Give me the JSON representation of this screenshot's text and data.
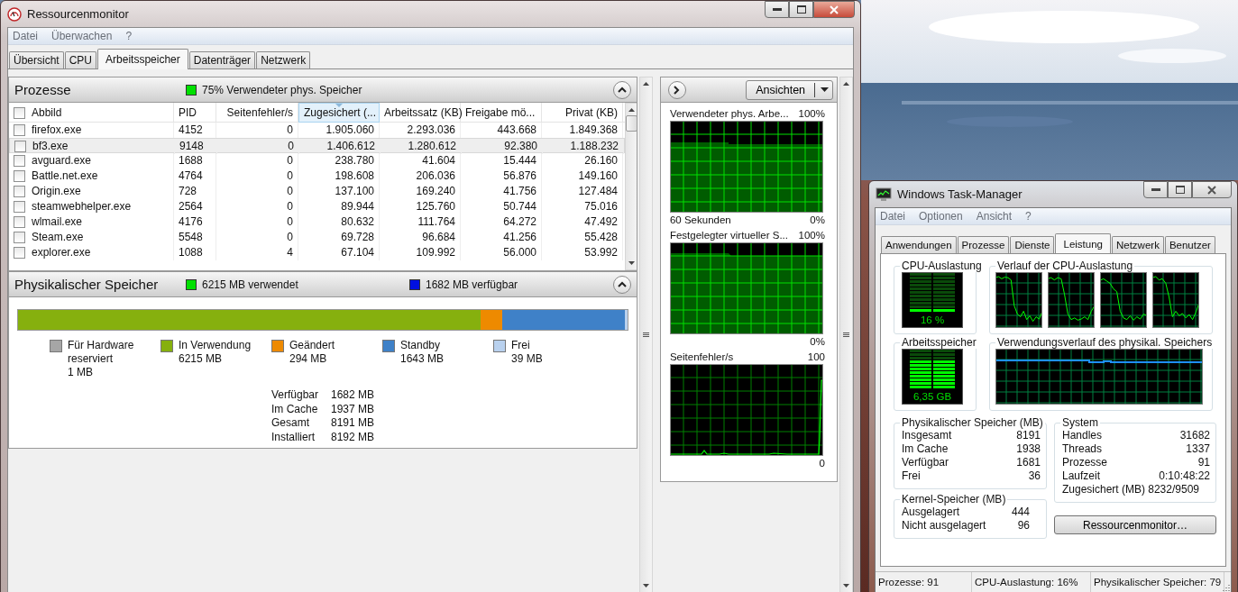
{
  "resmon": {
    "title": "Ressourcenmonitor",
    "menu": [
      "Datei",
      "Überwachen",
      "?"
    ],
    "tabs": [
      {
        "label": "Übersicht",
        "selected": false
      },
      {
        "label": "CPU",
        "selected": false
      },
      {
        "label": "Arbeitsspeicher",
        "selected": true
      },
      {
        "label": "Datenträger",
        "selected": false
      },
      {
        "label": "Netzwerk",
        "selected": false
      }
    ],
    "processes": {
      "title": "Prozesse",
      "status": "75% Verwendeter phys. Speicher",
      "columns": [
        {
          "label": "Abbild",
          "sorted": false
        },
        {
          "label": "PID",
          "sorted": false
        },
        {
          "label": "Seitenfehler/s",
          "sorted": false
        },
        {
          "label": "Zugesichert (...",
          "sorted": true
        },
        {
          "label": "Arbeitssatz (KB)",
          "sorted": false
        },
        {
          "label": "Freigabe mö...",
          "sorted": false
        },
        {
          "label": "Privat (KB)",
          "sorted": false
        }
      ],
      "rows": [
        {
          "checked": false,
          "selected": false,
          "cells": [
            "firefox.exe",
            "4152",
            "0",
            "1.905.060",
            "2.293.036",
            "443.668",
            "1.849.368"
          ]
        },
        {
          "checked": false,
          "selected": true,
          "cells": [
            "bf3.exe",
            "9148",
            "0",
            "1.406.612",
            "1.280.612",
            "92.380",
            "1.188.232"
          ]
        },
        {
          "checked": false,
          "selected": false,
          "cells": [
            "avguard.exe",
            "1688",
            "0",
            "238.780",
            "41.604",
            "15.444",
            "26.160"
          ]
        },
        {
          "checked": false,
          "selected": false,
          "cells": [
            "Battle.net.exe",
            "4764",
            "0",
            "198.608",
            "206.036",
            "56.876",
            "149.160"
          ]
        },
        {
          "checked": false,
          "selected": false,
          "cells": [
            "Origin.exe",
            "728",
            "0",
            "137.100",
            "169.240",
            "41.756",
            "127.484"
          ]
        },
        {
          "checked": false,
          "selected": false,
          "cells": [
            "steamwebhelper.exe",
            "2564",
            "0",
            "89.944",
            "125.760",
            "50.744",
            "75.016"
          ]
        },
        {
          "checked": false,
          "selected": false,
          "cells": [
            "wlmail.exe",
            "4176",
            "0",
            "80.632",
            "111.764",
            "64.272",
            "47.492"
          ]
        },
        {
          "checked": false,
          "selected": false,
          "cells": [
            "Steam.exe",
            "5548",
            "0",
            "69.728",
            "96.684",
            "41.256",
            "55.428"
          ]
        },
        {
          "checked": false,
          "selected": false,
          "cells": [
            "explorer.exe",
            "1088",
            "4",
            "67.104",
            "109.992",
            "56.000",
            "53.992"
          ]
        }
      ]
    },
    "memory": {
      "title": "Physikalischer Speicher",
      "used": "6215 MB verwendet",
      "available": "1682 MB verfügbar",
      "segments": [
        {
          "label": "Für Hardware reserviert",
          "value": "1 MB",
          "color": "#a6a6a6"
        },
        {
          "label": "In Verwendung",
          "value": "6215 MB",
          "color": "#86b00e"
        },
        {
          "label": "Geändert",
          "value": "294 MB",
          "color": "#ee8a00"
        },
        {
          "label": "Standby",
          "value": "1643 MB",
          "color": "#3f81c8"
        },
        {
          "label": "Frei",
          "value": "39 MB",
          "color": "#b9d1ee"
        }
      ],
      "stats": [
        {
          "label": "Verfügbar",
          "value": "1682 MB"
        },
        {
          "label": "Im Cache",
          "value": "1937 MB"
        },
        {
          "label": "Gesamt",
          "value": "8191 MB"
        },
        {
          "label": "Installiert",
          "value": "8192 MB"
        }
      ]
    },
    "views_button": "Ansichten",
    "graphs": [
      {
        "kind": "fill",
        "title": "Verwendeter phys. Arbe...",
        "max": "100%",
        "min": "0%",
        "caption": "60 Sekunden"
      },
      {
        "kind": "fill",
        "title": "Festgelegter virtueller S...",
        "max": "100%",
        "min": "0%"
      },
      {
        "kind": "spikes",
        "title": "Seitenfehler/s",
        "max": "100",
        "min": "0"
      }
    ]
  },
  "taskmgr": {
    "title": "Windows Task-Manager",
    "menu": [
      "Datei",
      "Optionen",
      "Ansicht",
      "?"
    ],
    "tabs": [
      {
        "label": "Anwendungen",
        "selected": false
      },
      {
        "label": "Prozesse",
        "selected": false
      },
      {
        "label": "Dienste",
        "selected": false
      },
      {
        "label": "Leistung",
        "selected": true
      },
      {
        "label": "Netzwerk",
        "selected": false
      },
      {
        "label": "Benutzer",
        "selected": false
      }
    ],
    "cpu": {
      "title": "CPU-Auslastung",
      "reading": "16 %",
      "level": 0.16
    },
    "cpu_history": {
      "title": "Verlauf der CPU-Auslastung"
    },
    "memory": {
      "title": "Arbeitsspeicher",
      "reading": "6,35 GB",
      "level": 0.78
    },
    "memory_history": {
      "title": "Verwendungsverlauf des physikal. Speichers"
    },
    "physical": {
      "title": "Physikalischer Speicher (MB)",
      "rows": [
        {
          "label": "Insgesamt",
          "value": "8191"
        },
        {
          "label": "Im Cache",
          "value": "1938"
        },
        {
          "label": "Verfügbar",
          "value": "1681"
        },
        {
          "label": "Frei",
          "value": "36"
        }
      ]
    },
    "kernel": {
      "title": "Kernel-Speicher (MB)",
      "rows": [
        {
          "label": "Ausgelagert",
          "value": "444"
        },
        {
          "label": "Nicht ausgelagert",
          "value": "96"
        }
      ]
    },
    "system": {
      "title": "System",
      "rows": [
        {
          "label": "Handles",
          "value": "31682"
        },
        {
          "label": "Threads",
          "value": "1337"
        },
        {
          "label": "Prozesse",
          "value": "91"
        },
        {
          "label": "Laufzeit",
          "value": "0:10:48:22"
        },
        {
          "label": "Zugesichert (MB)",
          "value": "8232/9509"
        }
      ]
    },
    "button": "Ressourcenmonitor…",
    "status": [
      "Prozesse: 91",
      "CPU-Auslastung: 16%",
      "Physikalischer Speicher: 79"
    ]
  }
}
